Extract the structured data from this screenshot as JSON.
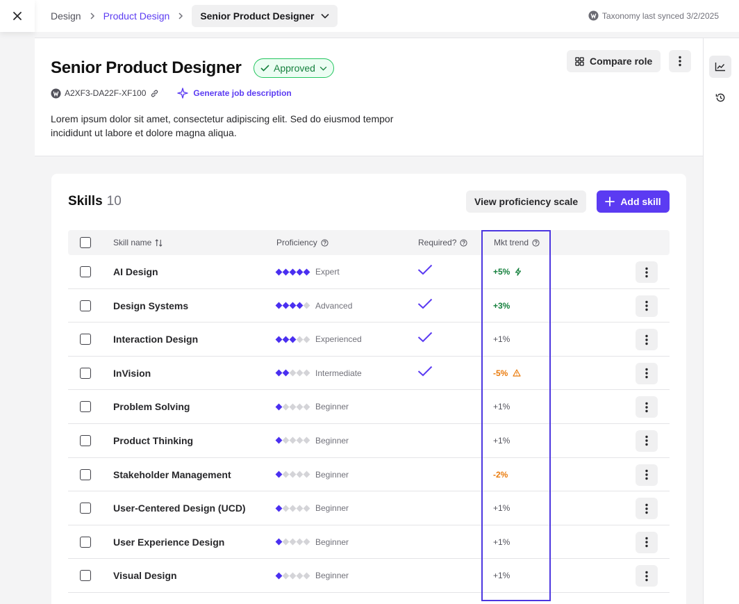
{
  "breadcrumb": {
    "items": [
      "Design",
      "Product Design"
    ],
    "current": "Senior Product Designer"
  },
  "sync": {
    "text": "Taxonomy last synced 3/2/2025"
  },
  "header": {
    "title": "Senior Product Designer",
    "status": "Approved",
    "code": "A2XF3-DA22F-XF100",
    "generate_label": "Generate job description",
    "description": "Lorem ipsum dolor sit amet, consectetur adipiscing elit. Sed do eiusmod tempor incididunt ut labore et dolore magna aliqua.",
    "compare_label": "Compare role"
  },
  "skills": {
    "title": "Skills",
    "count": "10",
    "view_scale_label": "View proficiency scale",
    "add_label": "Add skill",
    "columns": {
      "name": "Skill name",
      "proficiency": "Proficiency",
      "required": "Required?",
      "trend": "Mkt trend"
    },
    "rows": [
      {
        "name": "AI Design",
        "level": 5,
        "proficiency": "Expert",
        "required": true,
        "trend": "+5%",
        "trend_type": "up",
        "trend_icon": "bolt-icon"
      },
      {
        "name": "Design Systems",
        "level": 4,
        "proficiency": "Advanced",
        "required": true,
        "trend": "+3%",
        "trend_type": "up",
        "trend_icon": ""
      },
      {
        "name": "Interaction Design",
        "level": 3,
        "proficiency": "Experienced",
        "required": true,
        "trend": "+1%",
        "trend_type": "neutral",
        "trend_icon": ""
      },
      {
        "name": "InVision",
        "level": 2,
        "proficiency": "Intermediate",
        "required": true,
        "trend": "-5%",
        "trend_type": "down",
        "trend_icon": "warning-icon"
      },
      {
        "name": "Problem Solving",
        "level": 1,
        "proficiency": "Beginner",
        "required": false,
        "trend": "+1%",
        "trend_type": "neutral",
        "trend_icon": ""
      },
      {
        "name": "Product Thinking",
        "level": 1,
        "proficiency": "Beginner",
        "required": false,
        "trend": "+1%",
        "trend_type": "neutral",
        "trend_icon": ""
      },
      {
        "name": "Stakeholder Management",
        "level": 1,
        "proficiency": "Beginner",
        "required": false,
        "trend": "-2%",
        "trend_type": "down",
        "trend_icon": ""
      },
      {
        "name": "User-Centered Design (UCD)",
        "level": 1,
        "proficiency": "Beginner",
        "required": false,
        "trend": "+1%",
        "trend_type": "neutral",
        "trend_icon": ""
      },
      {
        "name": "User Experience Design",
        "level": 1,
        "proficiency": "Beginner",
        "required": false,
        "trend": "+1%",
        "trend_type": "neutral",
        "trend_icon": ""
      },
      {
        "name": "Visual Design",
        "level": 1,
        "proficiency": "Beginner",
        "required": false,
        "trend": "+1%",
        "trend_type": "neutral",
        "trend_icon": ""
      }
    ]
  },
  "colors": {
    "accent": "#5b3bf2",
    "approved": "#15803d",
    "trend_up": "#15803d",
    "trend_down": "#ea7b0c",
    "highlight": "#4c36e0"
  }
}
